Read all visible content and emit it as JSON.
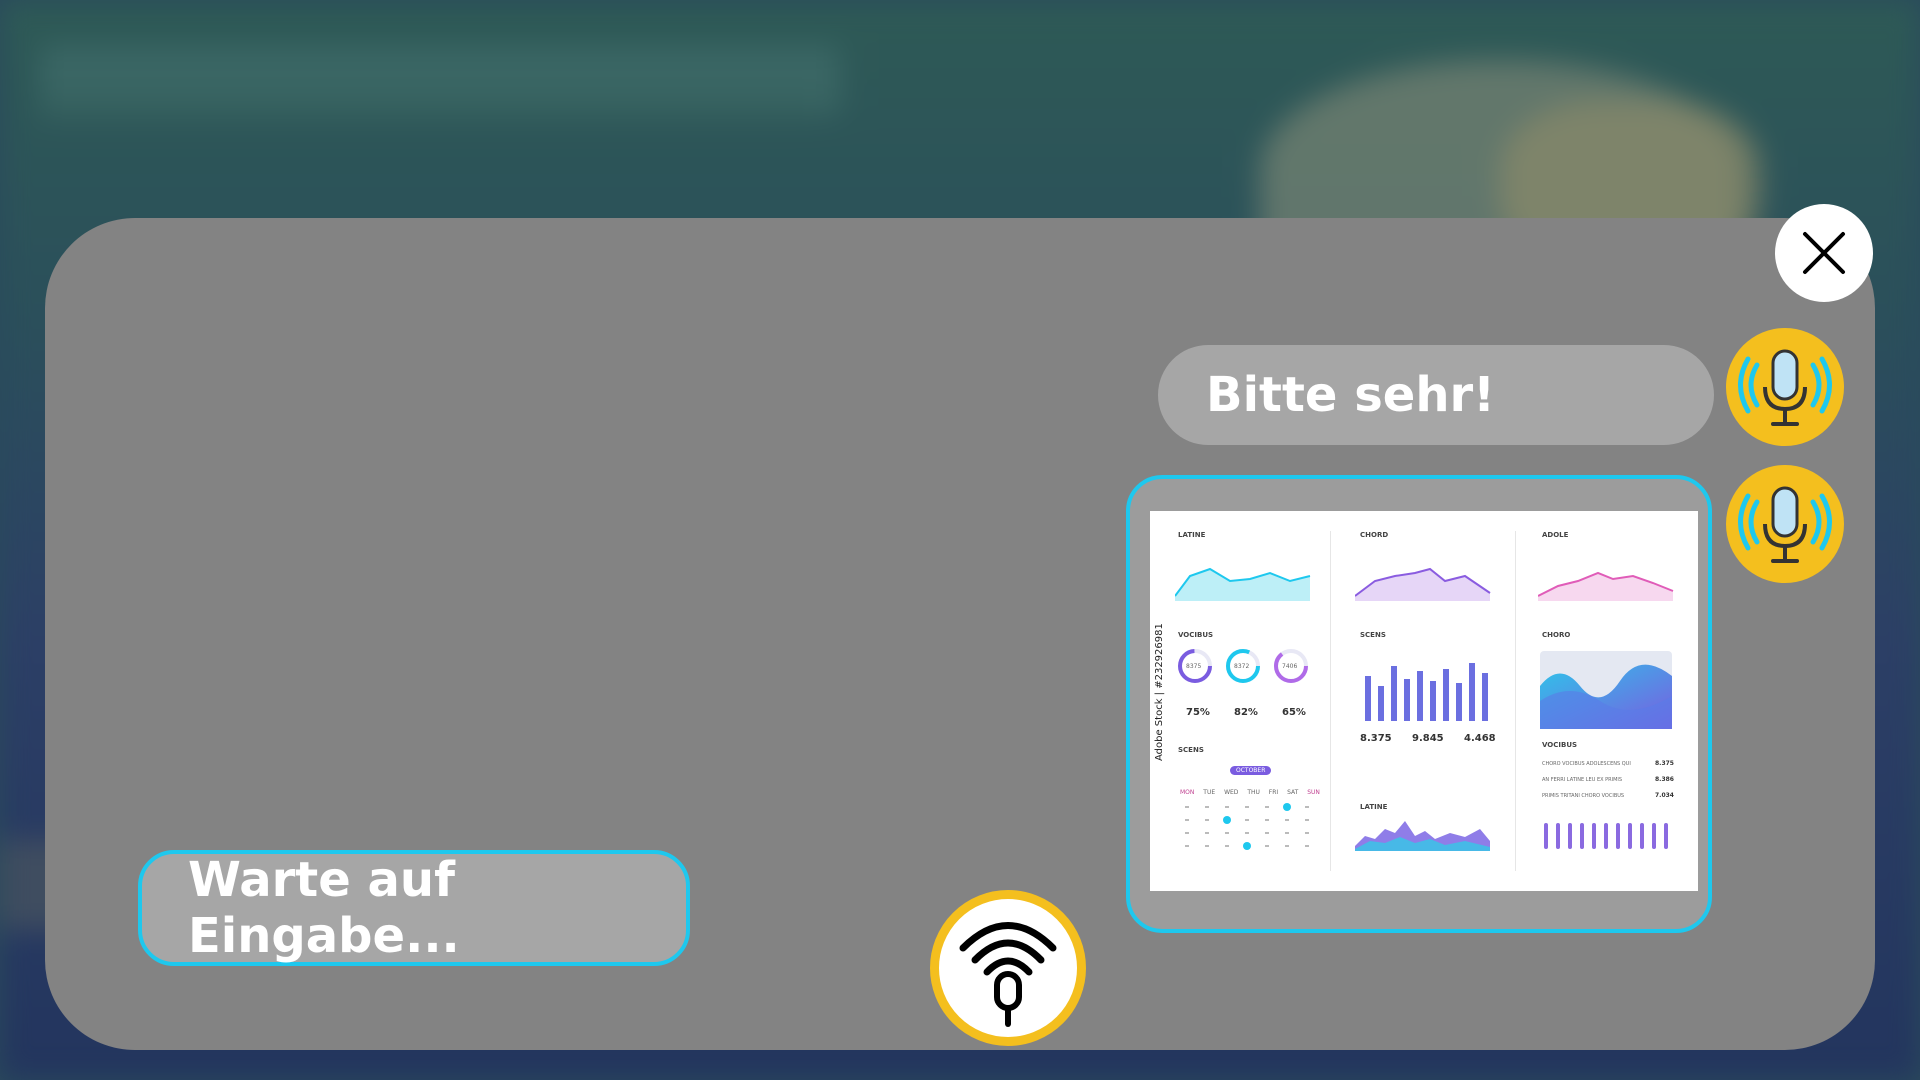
{
  "colors": {
    "panel": "#838383",
    "bubble": "#a6a6a6",
    "accent_border": "#1ec8ee",
    "avatar_yellow": "#f4bf1e",
    "mic_blue": "#bfe3f5",
    "wave_cyan": "#1ec8ee"
  },
  "close_button": {
    "icon": "close-icon"
  },
  "messages": [
    {
      "text": "Bitte sehr!",
      "avatar_icon": "voice-mic-icon"
    },
    {
      "type": "image",
      "avatar_icon": "voice-mic-icon"
    }
  ],
  "image_message": {
    "labels": {
      "col1_top": "LATINE",
      "col2_top": "CHORD",
      "col3_top": "ADOLE",
      "col1_mid": "VOCIBUS",
      "col2_mid": "SCENS",
      "col3_mid": "CHORO",
      "col1_bottom": "SCENS",
      "col2_bottom": "LATINE",
      "col3_bottom": "VOCIBUS",
      "month": "OCTOBER"
    },
    "donut_values": [
      "8375",
      "8372",
      "7406"
    ],
    "percents": [
      "75%",
      "82%",
      "65%"
    ],
    "stats": [
      "8.375",
      "9.845",
      "4.468"
    ],
    "list_values": [
      "8.375",
      "8.386",
      "7.034"
    ],
    "list_items": [
      "CHORO VOCIBUS ADOLESCENS QUI",
      "AN FERRI LATINE LEU EX PRIMIS",
      "PRIMIS TRITANI CHORO VOCIBUS"
    ],
    "weekdays": [
      "MON",
      "TUE",
      "WED",
      "THU",
      "FRI",
      "SAT",
      "SUN"
    ],
    "watermark": "Adobe Stock | #232926981"
  },
  "status_text": "Warte auf Eingabe...",
  "mic_button": {
    "icon": "mic-broadcast-icon"
  }
}
